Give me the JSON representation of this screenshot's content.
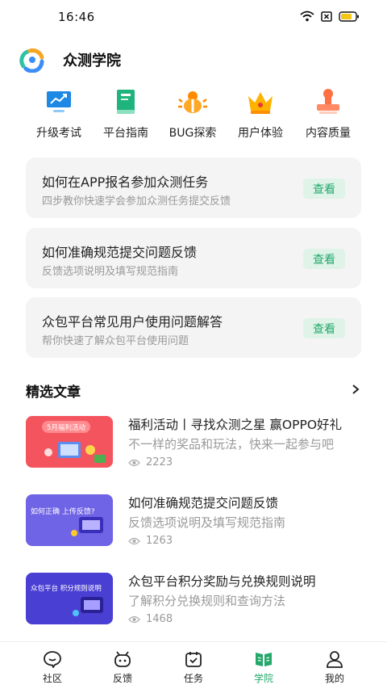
{
  "status_bar": {
    "time": "16:46"
  },
  "header": {
    "title": "众测学院"
  },
  "quick_entries": [
    {
      "label": "升级考试",
      "icon": "monitor-chart-icon"
    },
    {
      "label": "平台指南",
      "icon": "book-icon"
    },
    {
      "label": "BUG探索",
      "icon": "bug-icon"
    },
    {
      "label": "用户体验",
      "icon": "crown-icon"
    },
    {
      "label": "内容质量",
      "icon": "stamp-icon"
    }
  ],
  "guides": [
    {
      "title": "如何在APP报名参加众测任务",
      "subtitle": "四步教你快速学会参加众测任务提交反馈",
      "button": "查看"
    },
    {
      "title": "如何准确规范提交问题反馈",
      "subtitle": "反馈选项说明及填写规范指南",
      "button": "查看"
    },
    {
      "title": "众包平台常见用户使用问题解答",
      "subtitle": "帮你快速了解众包平台使用问题",
      "button": "查看"
    }
  ],
  "featured": {
    "title": "精选文章",
    "articles": [
      {
        "title": "福利活动丨寻找众测之星 赢OPPO好礼",
        "subtitle": "不一样的奖品和玩法，快来一起参与吧",
        "views": "2223",
        "thumb_text": "5月福利活动",
        "thumb_color": "#f4545d"
      },
      {
        "title": "如何准确规范提交问题反馈",
        "subtitle": "反馈选项说明及填写规范指南",
        "views": "1263",
        "thumb_text": "如何正确 上传反馈?",
        "thumb_color": "#6f63e6"
      },
      {
        "title": "众包平台积分奖励与兑换规则说明",
        "subtitle": "了解积分兑换规则和查询方法",
        "views": "1468",
        "thumb_text": "众包平台 积分规则说明",
        "thumb_color": "#4a3fd3"
      }
    ]
  },
  "tabs": [
    {
      "label": "社区",
      "icon": "community-icon",
      "active": false
    },
    {
      "label": "反馈",
      "icon": "feedback-icon",
      "active": false
    },
    {
      "label": "任务",
      "icon": "task-icon",
      "active": false
    },
    {
      "label": "学院",
      "icon": "academy-icon",
      "active": true
    },
    {
      "label": "我的",
      "icon": "profile-icon",
      "active": false
    }
  ],
  "colors": {
    "accent": "#23a86a",
    "card_bg": "#f4f4f4",
    "button_bg": "#dff3e8"
  }
}
